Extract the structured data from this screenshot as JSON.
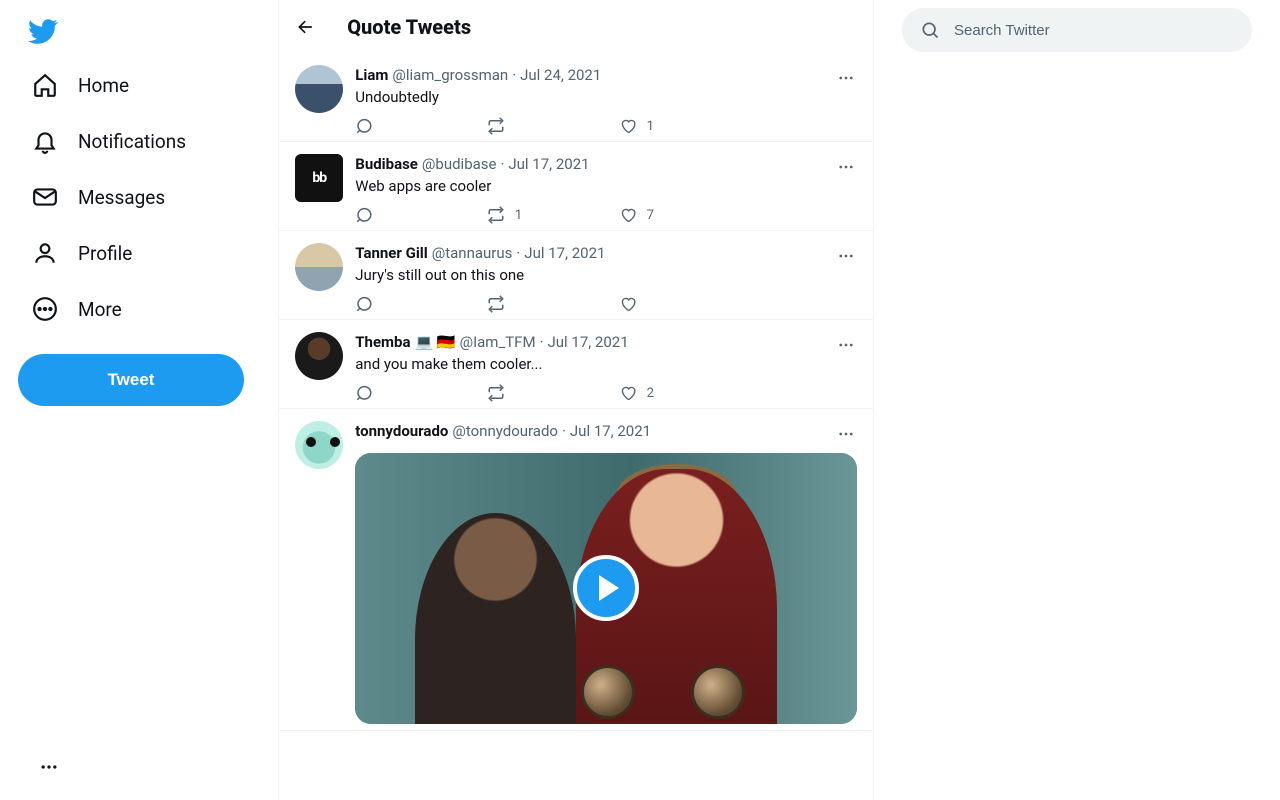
{
  "nav": {
    "home": "Home",
    "notifications": "Notifications",
    "messages": "Messages",
    "profile": "Profile",
    "more": "More",
    "tweet_button": "Tweet"
  },
  "header": {
    "title": "Quote Tweets"
  },
  "search": {
    "placeholder": "Search Twitter"
  },
  "tweets": [
    {
      "name": "Liam",
      "handle": "@liam_grossman",
      "date": "Jul 24, 2021",
      "text": "Undoubtedly",
      "reply": "",
      "retweet": "",
      "like": "1",
      "avatar_class": "av1",
      "avatar_square": false,
      "emoji": "",
      "media": false
    },
    {
      "name": "Budibase",
      "handle": "@budibase",
      "date": "Jul 17, 2021",
      "text": "Web apps are cooler",
      "reply": "",
      "retweet": "1",
      "like": "7",
      "avatar_class": "av2",
      "avatar_label": "bb",
      "avatar_square": true,
      "emoji": "",
      "media": false
    },
    {
      "name": "Tanner Gill",
      "handle": "@tannaurus",
      "date": "Jul 17, 2021",
      "text": "Jury's still out on this one",
      "reply": "",
      "retweet": "",
      "like": "",
      "avatar_class": "av3",
      "avatar_square": false,
      "emoji": "",
      "media": false
    },
    {
      "name": "Themba",
      "handle": "@Iam_TFM",
      "date": "Jul 17, 2021",
      "text": "and you make them cooler...",
      "reply": "",
      "retweet": "",
      "like": "2",
      "avatar_class": "av4",
      "avatar_square": false,
      "emoji": "💻 🇩🇪",
      "media": false
    },
    {
      "name": "tonnydourado",
      "handle": "@tonnydourado",
      "date": "Jul 17, 2021",
      "text": "",
      "reply": "",
      "retweet": "",
      "like": "",
      "avatar_class": "av5",
      "avatar_square": false,
      "emoji": "",
      "media": true
    }
  ]
}
